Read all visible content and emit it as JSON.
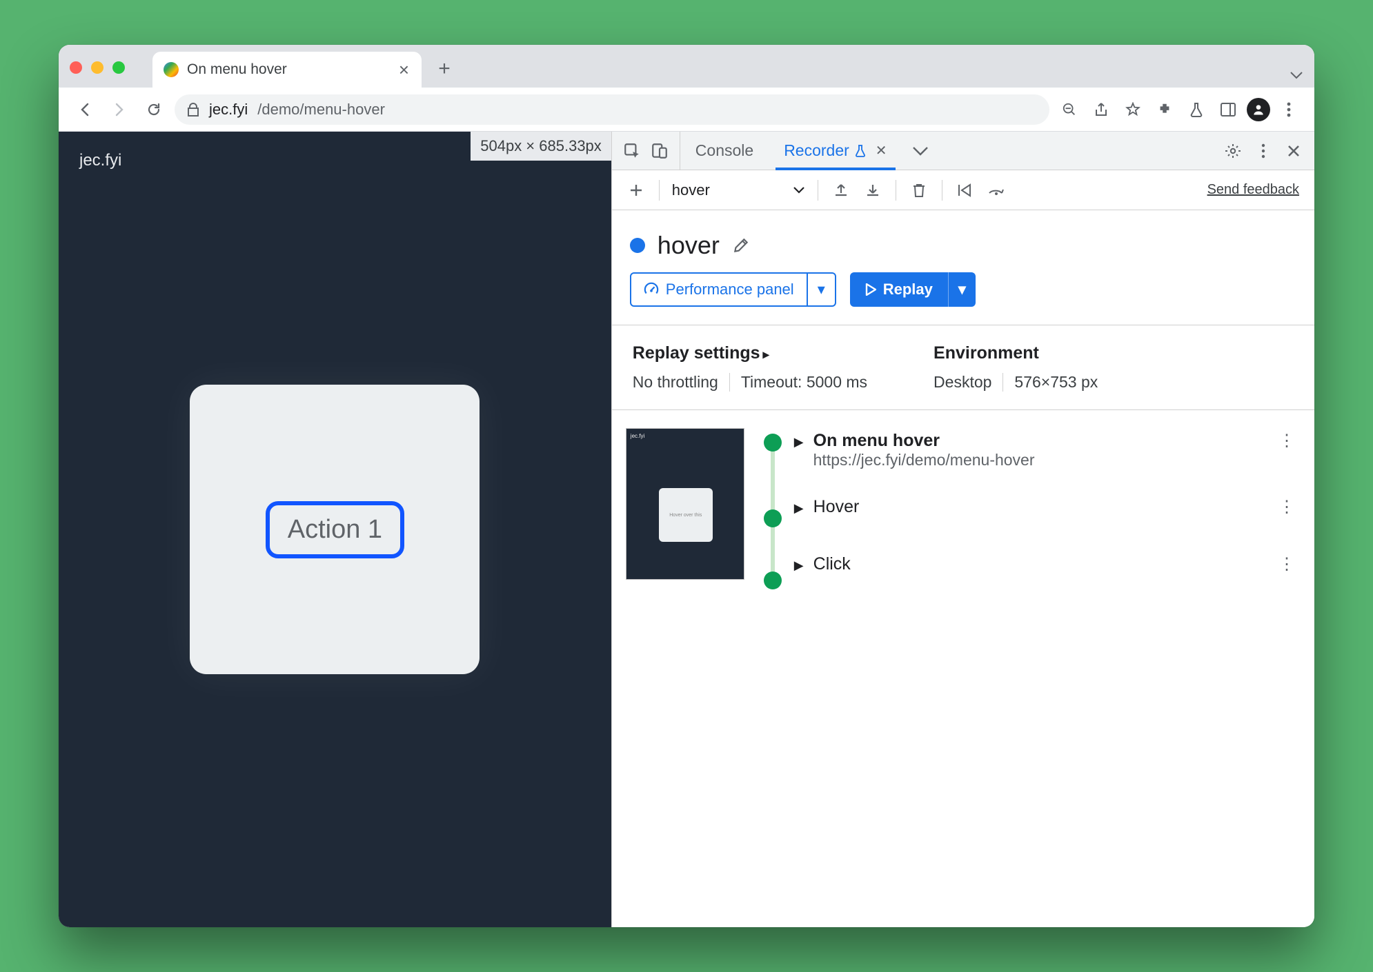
{
  "browser": {
    "tab_title": "On menu hover",
    "url_host": "jec.fyi",
    "url_path": "/demo/menu-hover"
  },
  "page": {
    "brand": "jec.fyi",
    "size_badge": "504px × 685.33px",
    "action_button": "Action 1"
  },
  "devtools": {
    "tabs": {
      "console": "Console",
      "recorder": "Recorder"
    },
    "toolbar": {
      "dropdown": "hover",
      "feedback": "Send feedback"
    },
    "recording": {
      "title": "hover",
      "perf_btn": "Performance panel",
      "replay_btn": "Replay"
    },
    "settings": {
      "replay_heading": "Replay settings",
      "throttle": "No throttling",
      "timeout": "Timeout: 5000 ms",
      "env_heading": "Environment",
      "device": "Desktop",
      "viewport": "576×753 px"
    },
    "steps": {
      "s1_title": "On menu hover",
      "s1_url": "https://jec.fyi/demo/menu-hover",
      "s2_title": "Hover",
      "s3_title": "Click",
      "thumb_brand": "jec.fyi",
      "thumb_text": "Hover over this"
    }
  }
}
